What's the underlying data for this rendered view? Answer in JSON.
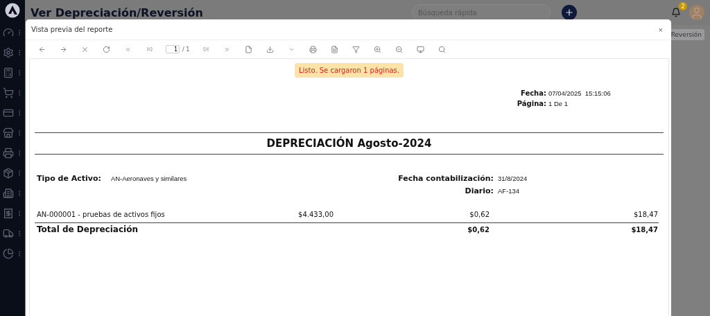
{
  "app": {
    "title": "Ver Depreciación/Reversión",
    "search": {
      "placeholder": "Búsqueda rápida"
    },
    "notifications": "2",
    "behind_button": "Reversión"
  },
  "dialog": {
    "title": "Vista previa del reporte",
    "close": "×",
    "toolbar": {
      "page_value": "1",
      "page_total": "/ 1"
    },
    "notice": "Listo. Se cargaron 1 páginas.",
    "report": {
      "meta": [
        {
          "label": "Fecha:",
          "value": "07/04/2025  15:15:06"
        },
        {
          "label": "Página:",
          "value": "1 De 1"
        }
      ],
      "title": "DEPRECIACIÓN Agosto-2024",
      "asset_type": {
        "label": "Tipo de Activo:",
        "value": "AN-Aeronaves y similares"
      },
      "posting": [
        {
          "label": "Fecha contabilización:",
          "value": "31/8/2024"
        },
        {
          "label": "Diario:",
          "value": "AF-134"
        }
      ],
      "rows": [
        {
          "name": "AN-000001 - pruebas de activos fijos",
          "column_2": "$4.433,00",
          "column_3": "$0,62",
          "column_4": "$18,47"
        }
      ],
      "total": {
        "label": "Total de Depreciación",
        "column_3": "$0,62",
        "column_4": "$18,47"
      }
    }
  }
}
